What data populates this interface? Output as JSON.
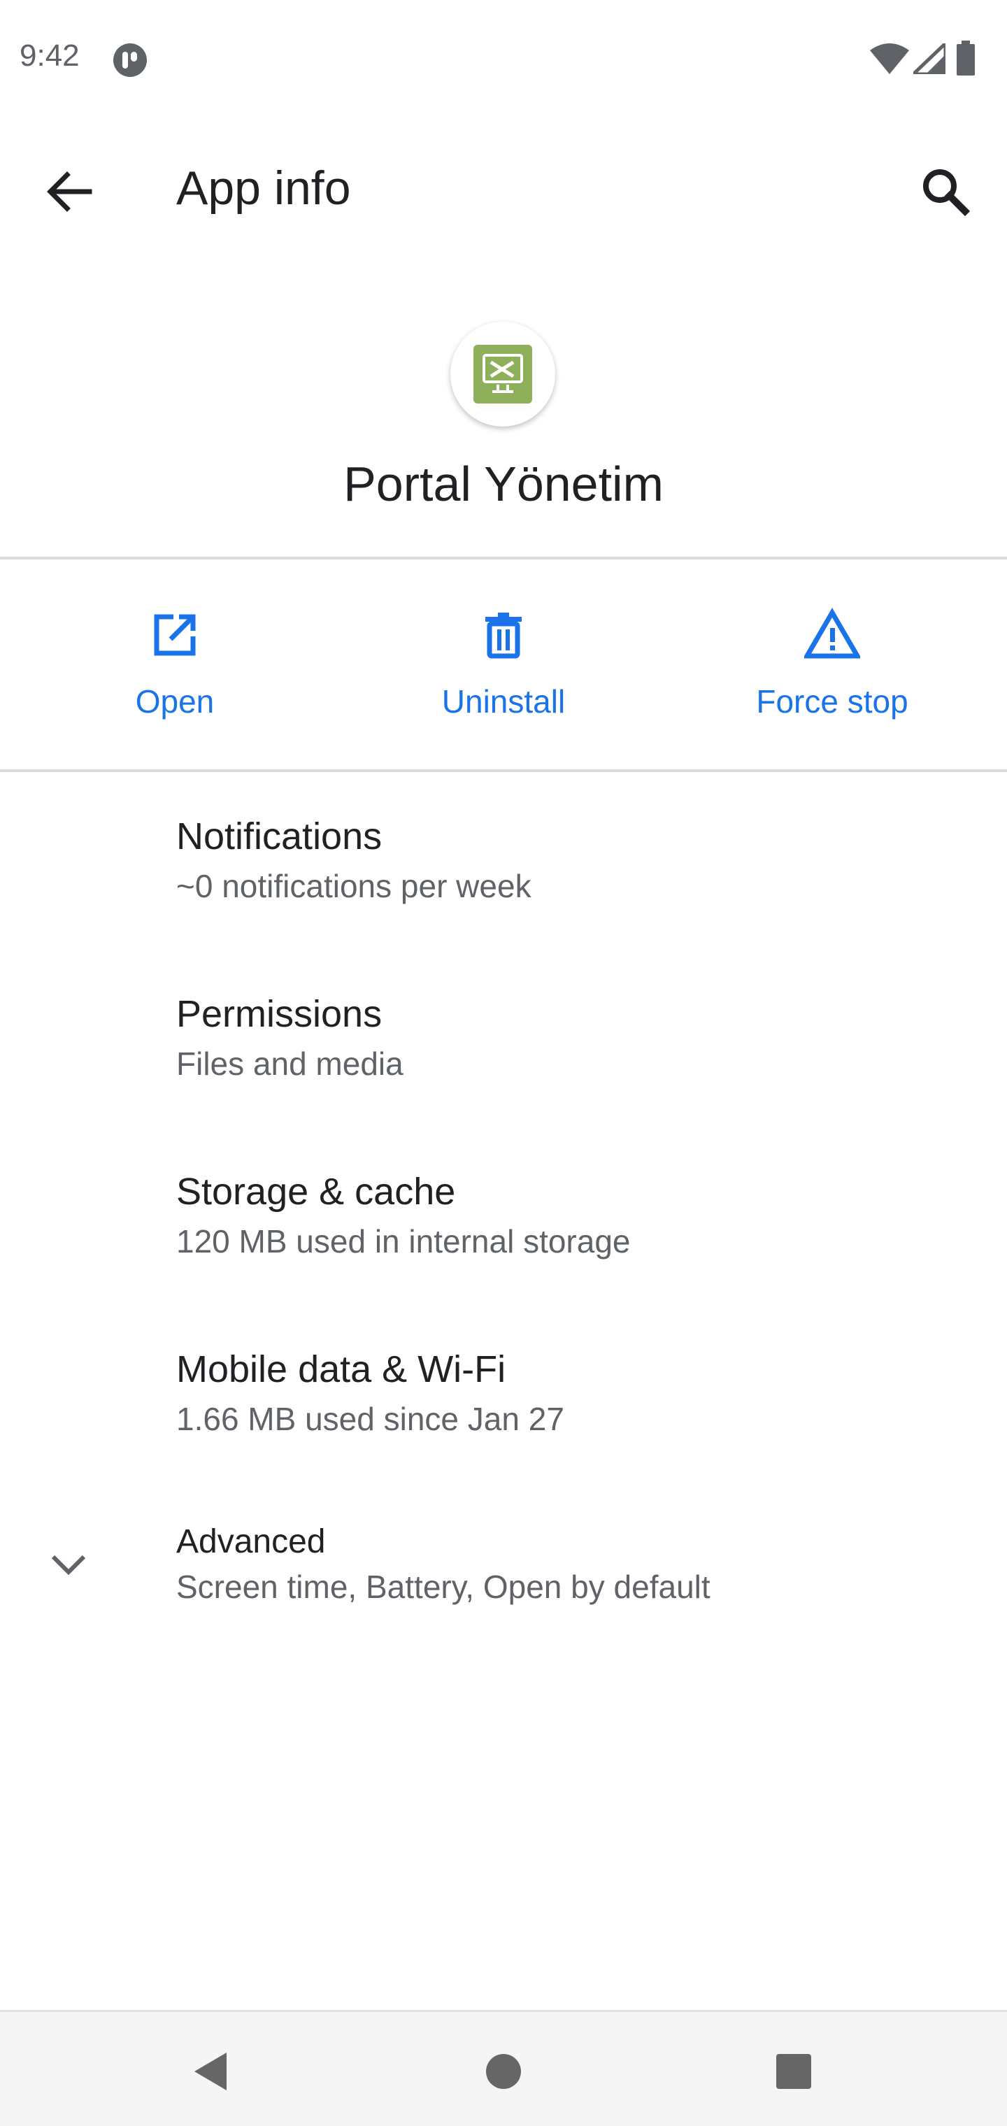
{
  "status_bar": {
    "time": "9:42",
    "icons": [
      "app-notification-icon",
      "wifi-icon",
      "cellular-signal-icon",
      "battery-icon"
    ]
  },
  "toolbar": {
    "title": "App info",
    "back_icon": "arrow-back-icon",
    "search_icon": "search-icon"
  },
  "app": {
    "name": "Portal Yönetim",
    "icon": "app-logo-icon",
    "icon_color": "#8fb05a"
  },
  "actions": [
    {
      "label": "Open",
      "icon": "open-external-icon"
    },
    {
      "label": "Uninstall",
      "icon": "trash-icon"
    },
    {
      "label": "Force stop",
      "icon": "warning-icon"
    }
  ],
  "settings": [
    {
      "title": "Notifications",
      "subtitle": "~0 notifications per week"
    },
    {
      "title": "Permissions",
      "subtitle": "Files and media"
    },
    {
      "title": "Storage & cache",
      "subtitle": "120 MB used in internal storage"
    },
    {
      "title": "Mobile data & Wi-Fi",
      "subtitle": "1.66 MB used since Jan 27"
    },
    {
      "title": "Advanced",
      "subtitle": "Screen time, Battery, Open by default"
    }
  ],
  "navigation": {
    "back": "nav-back-icon",
    "home": "nav-home-icon",
    "recents": "nav-recents-icon"
  },
  "colors": {
    "accent": "#1a73e8",
    "primary_text": "#202124",
    "secondary_text": "#5f6368",
    "divider": "#dadce0"
  }
}
